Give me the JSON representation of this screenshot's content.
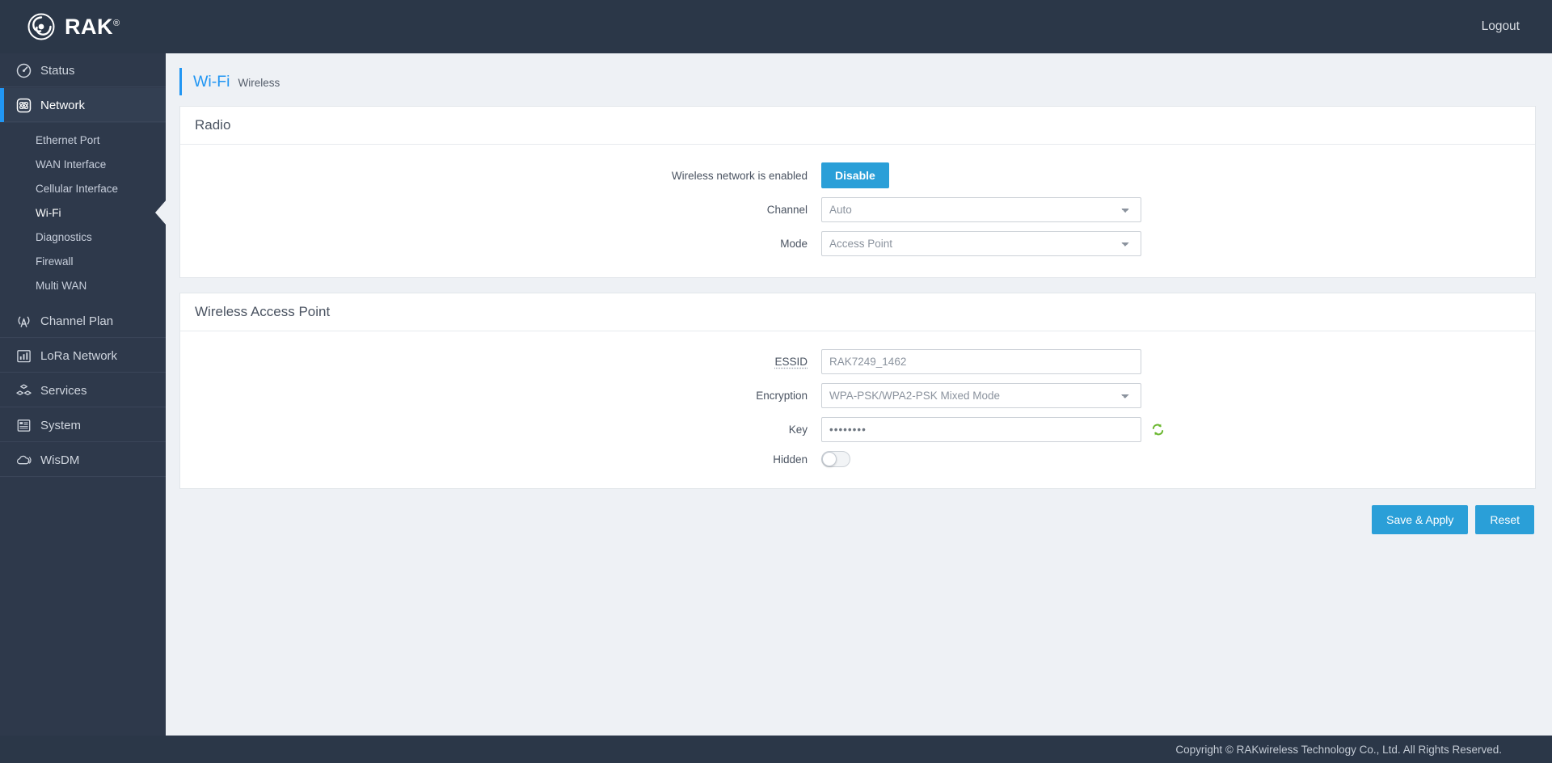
{
  "header": {
    "brand": "RAK",
    "brand_sup": "®",
    "logout": "Logout",
    "logo_icon": "rak-swirl-logo-icon"
  },
  "sidebar": {
    "items": [
      {
        "label": "Status",
        "icon": "dashboard-gauge-icon",
        "active": false
      },
      {
        "label": "Network",
        "icon": "network-atom-icon",
        "active": true
      },
      {
        "label": "Channel Plan",
        "icon": "antenna-broadcast-icon",
        "active": false
      },
      {
        "label": "LoRa Network",
        "icon": "bar-chart-icon",
        "active": false
      },
      {
        "label": "Services",
        "icon": "blocks-cubes-icon",
        "active": false
      },
      {
        "label": "System",
        "icon": "server-list-icon",
        "active": false
      },
      {
        "label": "WisDM",
        "icon": "cloud-signal-icon",
        "active": false
      }
    ],
    "network_subitems": [
      {
        "label": "Ethernet Port",
        "current": false
      },
      {
        "label": "WAN Interface",
        "current": false
      },
      {
        "label": "Cellular Interface",
        "current": false
      },
      {
        "label": "Wi-Fi",
        "current": true
      },
      {
        "label": "Diagnostics",
        "current": false
      },
      {
        "label": "Firewall",
        "current": false
      },
      {
        "label": "Multi WAN",
        "current": false
      }
    ]
  },
  "page": {
    "title": "Wi-Fi",
    "subtitle": "Wireless"
  },
  "radio": {
    "heading": "Radio",
    "enabled_label": "Wireless network is enabled",
    "disable_button": "Disable",
    "channel_label": "Channel",
    "channel_value": "Auto",
    "channel_options": [
      "Auto"
    ],
    "mode_label": "Mode",
    "mode_value": "Access Point",
    "mode_options": [
      "Access Point"
    ]
  },
  "access_point": {
    "heading": "Wireless Access Point",
    "essid_label": "ESSID",
    "essid_value": "RAK7249_1462",
    "encryption_label": "Encryption",
    "encryption_value": "WPA-PSK/WPA2-PSK Mixed Mode",
    "encryption_options": [
      "WPA-PSK/WPA2-PSK Mixed Mode"
    ],
    "key_label": "Key",
    "key_value": "••••••••",
    "key_regen_icon": "regenerate-refresh-icon",
    "hidden_label": "Hidden",
    "hidden_state": "off"
  },
  "actions": {
    "save": "Save & Apply",
    "reset": "Reset"
  },
  "footer": {
    "copyright": "Copyright © RAKwireless Technology Co., Ltd. All Rights Reserved."
  },
  "colors": {
    "accent": "#2196f3",
    "button": "#2a9fd8",
    "sidebar": "#2e394b",
    "topbar": "#2b3748",
    "page_bg": "#eef1f5"
  }
}
